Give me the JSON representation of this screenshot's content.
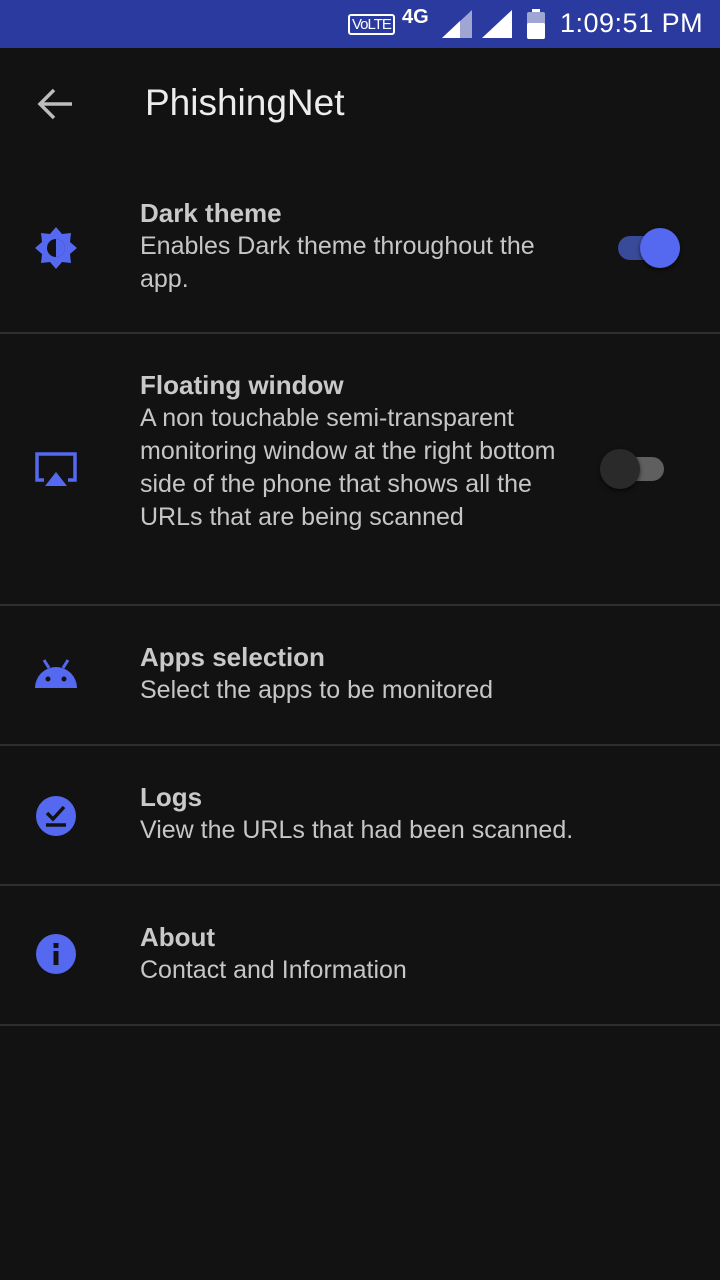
{
  "status_bar": {
    "volte": "VoLTE",
    "network": "4G",
    "time": "1:09:51 PM"
  },
  "app_bar": {
    "title": "PhishingNet",
    "back_icon": "arrow-back-icon"
  },
  "settings": [
    {
      "icon": "brightness-icon",
      "title": "Dark theme",
      "subtitle": "Enables Dark theme throughout the app.",
      "toggle": true
    },
    {
      "icon": "airplay-icon",
      "title": "Floating window",
      "subtitle": "A non touchable semi-transparent monitoring window at the right bottom side of the phone that shows all the URLs that are being scanned",
      "toggle": false
    },
    {
      "icon": "android-icon",
      "title": "Apps selection",
      "subtitle": "Select the apps to be monitored"
    },
    {
      "icon": "check-circle-icon",
      "title": "Logs",
      "subtitle": "View the URLs that had been scanned."
    },
    {
      "icon": "info-icon",
      "title": "About",
      "subtitle": "Contact and Information"
    }
  ],
  "colors": {
    "background": "#121212",
    "status_bar": "#2b3a9e",
    "accent": "#5469f0",
    "divider": "#2e2e2e",
    "switch_on_track": "#3a4a9a",
    "switch_off_thumb": "#2a2a2a",
    "switch_off_track": "#5f5f5f"
  }
}
